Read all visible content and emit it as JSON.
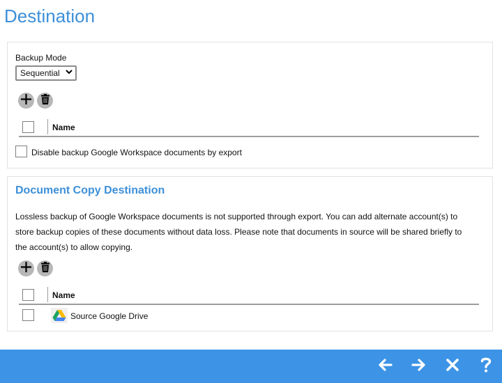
{
  "page": {
    "title": "Destination"
  },
  "backup": {
    "mode_label": "Backup Mode",
    "mode_value": "Sequential",
    "table": {
      "name_header": "Name",
      "rows": []
    },
    "disable_export_label": "Disable backup Google Workspace documents by export"
  },
  "copy_dest": {
    "title": "Document Copy Destination",
    "description_lines": [
      "Lossless backup of Google Workspace documents is not supported through export. You can add alternate account(s) to",
      "store backup copies of these documents without data loss. Please note that documents in source will be shared briefly to",
      "the account(s) to allow copying."
    ],
    "table": {
      "name_header": "Name",
      "rows": [
        {
          "name": "Source Google Drive",
          "icon": "google-drive-icon"
        }
      ]
    }
  },
  "footer": {
    "buttons": [
      "back-arrow-icon",
      "next-arrow-icon",
      "close-x-icon",
      "help-question-icon"
    ]
  },
  "colors": {
    "accent": "#3d8fd8",
    "footer": "#3d94e6",
    "icon_bg": "#b7b7b7"
  }
}
